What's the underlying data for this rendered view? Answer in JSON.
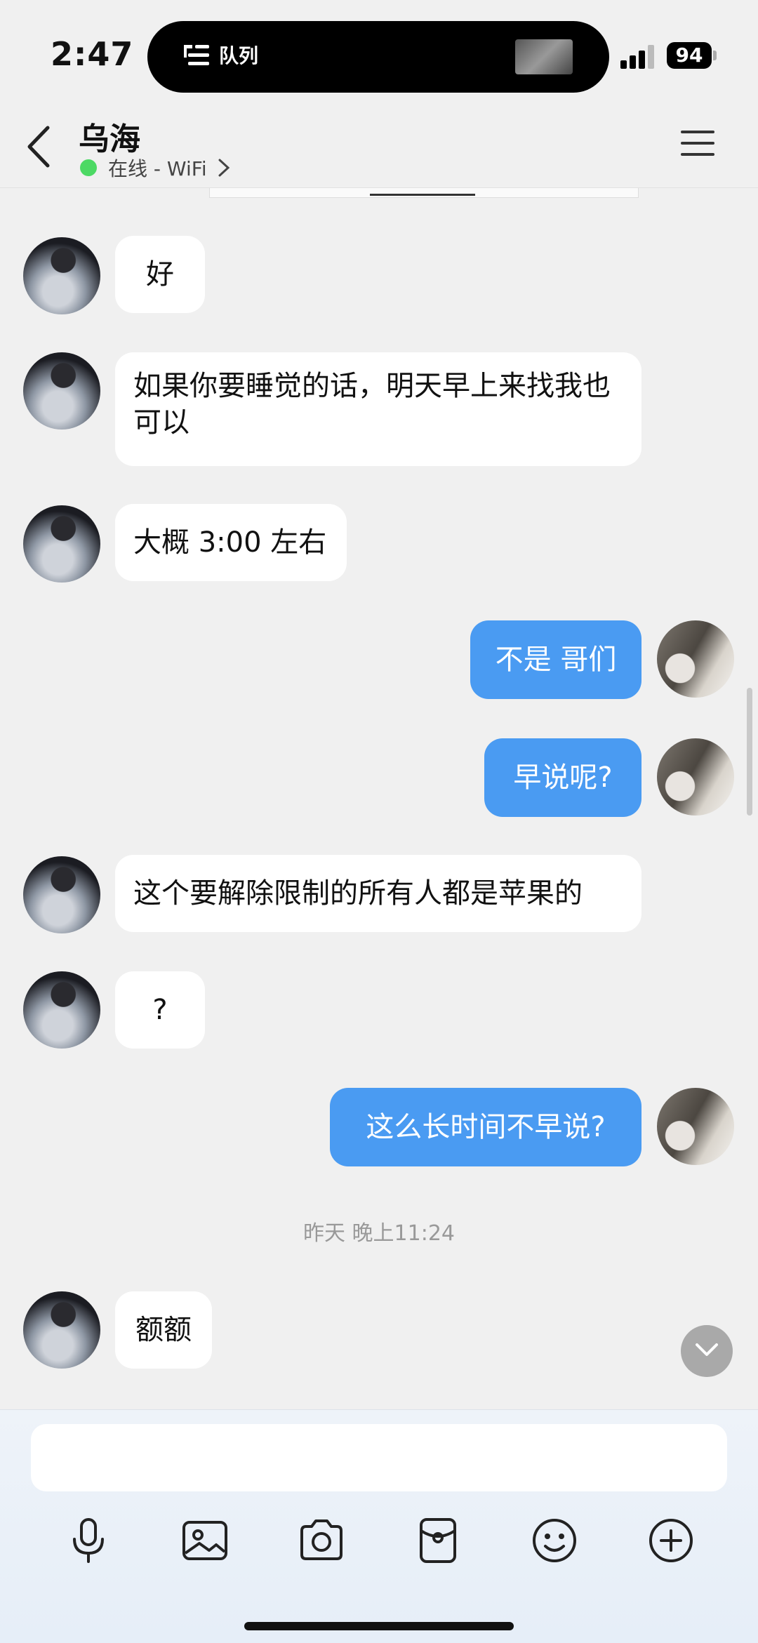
{
  "status_bar": {
    "time": "2:47",
    "island_label": "队列",
    "battery": "94"
  },
  "header": {
    "contact_name": "乌海",
    "presence": "在线 - WiFi"
  },
  "messages": [
    {
      "side": "in",
      "text": "好"
    },
    {
      "side": "in",
      "text": "如果你要睡觉的话，明天早上来找我也可以"
    },
    {
      "side": "in",
      "text": "大概 3:00 左右"
    },
    {
      "side": "out",
      "text": "不是 哥们"
    },
    {
      "side": "out",
      "text": "早说呢?"
    },
    {
      "side": "in",
      "text": "这个要解除限制的所有人都是苹果的"
    },
    {
      "side": "in",
      "text": "?"
    },
    {
      "side": "out",
      "text": "这么长时间不早说?"
    },
    {
      "side": "in",
      "text": "额额"
    }
  ],
  "timestamp": "昨天 晚上11:24",
  "composer": {
    "placeholder": "",
    "tools": [
      "microphone-icon",
      "image-icon",
      "camera-icon",
      "red-packet-icon",
      "emoji-icon",
      "plus-icon"
    ]
  },
  "colors": {
    "outgoing_bubble": "#4a9bf2",
    "incoming_bubble": "#ffffff",
    "online": "#4cd964",
    "background": "#f0f0f0"
  }
}
